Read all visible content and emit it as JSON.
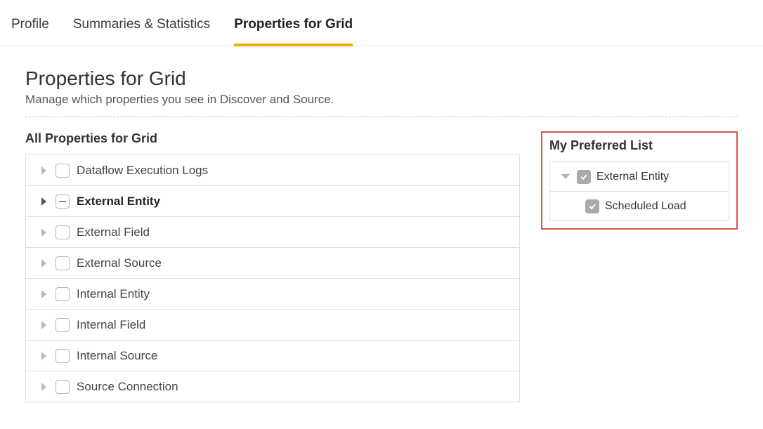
{
  "tabs": {
    "profile": "Profile",
    "summaries": "Summaries & Statistics",
    "properties": "Properties for Grid"
  },
  "page": {
    "title": "Properties for Grid",
    "subtitle": "Manage which properties you see in Discover and Source."
  },
  "all_properties": {
    "heading": "All Properties for Grid",
    "items": [
      {
        "label": "Dataflow Execution Logs",
        "state": "unchecked",
        "expanded": false,
        "selected": false
      },
      {
        "label": "External Entity",
        "state": "mixed",
        "expanded": false,
        "selected": true
      },
      {
        "label": "External Field",
        "state": "unchecked",
        "expanded": false,
        "selected": false
      },
      {
        "label": "External Source",
        "state": "unchecked",
        "expanded": false,
        "selected": false
      },
      {
        "label": "Internal Entity",
        "state": "unchecked",
        "expanded": false,
        "selected": false
      },
      {
        "label": "Internal Field",
        "state": "unchecked",
        "expanded": false,
        "selected": false
      },
      {
        "label": "Internal Source",
        "state": "unchecked",
        "expanded": false,
        "selected": false
      },
      {
        "label": "Source Connection",
        "state": "unchecked",
        "expanded": false,
        "selected": false
      }
    ]
  },
  "preferred": {
    "heading": "My Preferred List",
    "items": [
      {
        "label": "External Entity",
        "checked": true,
        "expandable": true,
        "level": 0
      },
      {
        "label": "Scheduled Load",
        "checked": true,
        "expandable": false,
        "level": 1
      }
    ]
  }
}
